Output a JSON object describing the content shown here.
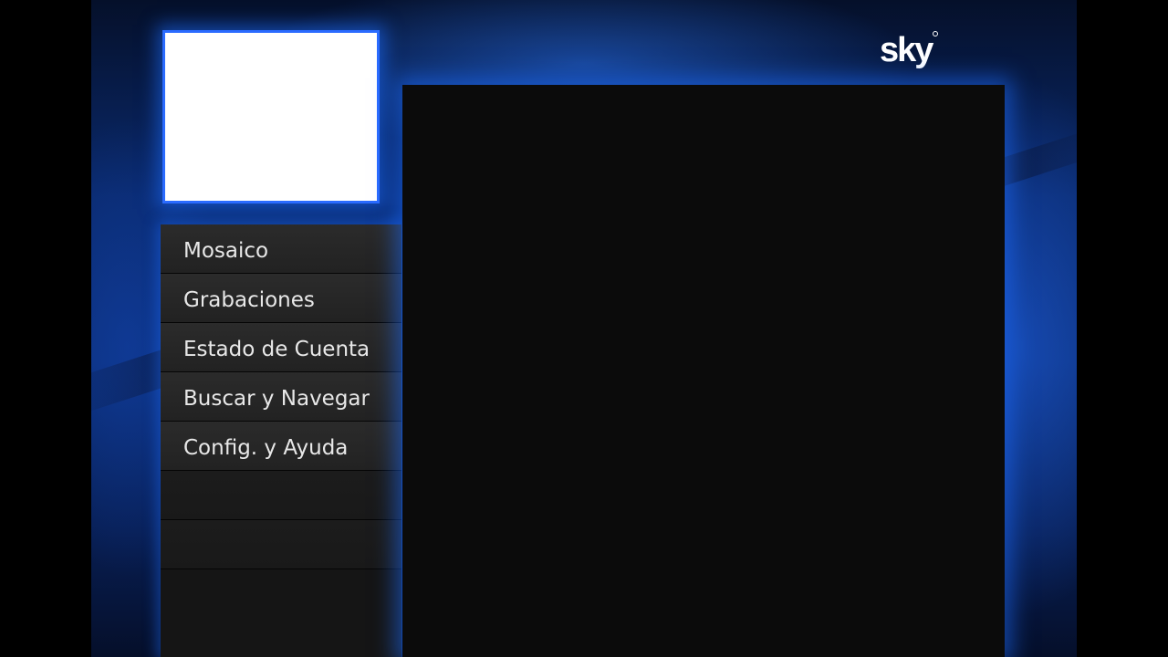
{
  "logo": {
    "text": "sky"
  },
  "preview": {
    "name": "video-preview"
  },
  "menu": {
    "items": [
      {
        "label": "Mosaico"
      },
      {
        "label": "Grabaciones"
      },
      {
        "label": "Estado de Cuenta"
      },
      {
        "label": "Buscar y Navegar"
      },
      {
        "label": "Config. y Ayuda"
      }
    ]
  },
  "colors": {
    "background_blue": "#0b2f7a",
    "glow_blue": "#2a6bff",
    "menu_item": "#2b2b2b",
    "panel": "#0b0b0b",
    "text": "#e8e8e8"
  }
}
